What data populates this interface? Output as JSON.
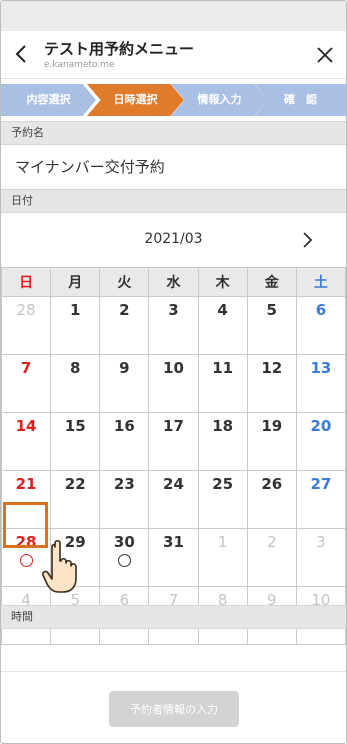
{
  "header": {
    "title": "テスト用予約メニュー",
    "domain": "e.kanameto.me"
  },
  "steps": [
    {
      "label": "内容選択"
    },
    {
      "label": "日時選択"
    },
    {
      "label": "情報入力"
    },
    {
      "label": "確　認"
    }
  ],
  "reservation": {
    "section_label": "予約名",
    "name": "マイナンバー交付予約"
  },
  "date": {
    "section_label": "日付",
    "month": "2021/03"
  },
  "calendar": {
    "weekdays": [
      "日",
      "月",
      "火",
      "水",
      "木",
      "金",
      "土"
    ],
    "weeks": [
      [
        "28",
        "1",
        "2",
        "3",
        "4",
        "5",
        "6"
      ],
      [
        "7",
        "8",
        "9",
        "10",
        "11",
        "12",
        "13"
      ],
      [
        "14",
        "15",
        "16",
        "17",
        "18",
        "19",
        "20"
      ],
      [
        "21",
        "22",
        "23",
        "24",
        "25",
        "26",
        "27"
      ],
      [
        "28",
        "29",
        "30",
        "31",
        "1",
        "2",
        "3"
      ],
      [
        "4",
        "5",
        "6",
        "7",
        "8",
        "9",
        "10"
      ]
    ],
    "available_mark": "○"
  },
  "time": {
    "section_label": "時間"
  },
  "footer": {
    "submit_label": "予約者情報の入力"
  },
  "colors": {
    "accent": "#e07b2c",
    "step_inactive": "#a9c0e4",
    "sunday": "#e02020",
    "saturday": "#3a7bd5"
  }
}
